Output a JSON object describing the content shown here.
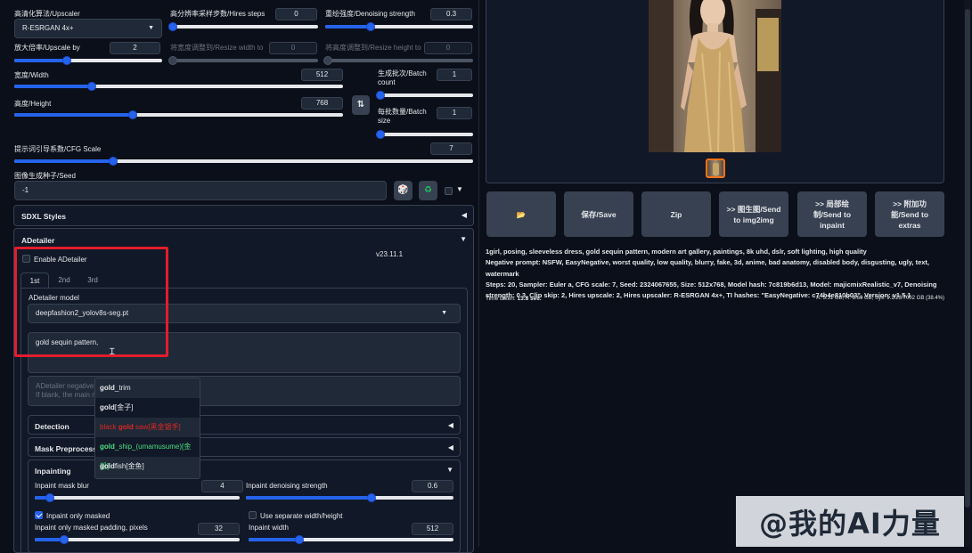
{
  "hires": {
    "upscaler_label": "高清化算法/Upscaler",
    "upscaler_value": "R-ESRGAN 4x+",
    "steps_label": "高分辨率采样步数/Hires steps",
    "steps_value": "0",
    "denoise_label": "重绘强度/Denoising strength",
    "denoise_value": "0.3",
    "upscale_by_label": "放大倍率/Upscale by",
    "upscale_by_value": "2",
    "resize_w_label": "将宽度调整到/Resize width to",
    "resize_w_value": "0",
    "resize_h_label": "将高度调整到/Resize height to",
    "resize_h_value": "0"
  },
  "size": {
    "width_label": "宽度/Width",
    "width_value": "512",
    "height_label": "高度/Height",
    "height_value": "768",
    "batch_count_label": "生成批次/Batch count",
    "batch_count_value": "1",
    "batch_size_label": "每批数量/Batch size",
    "batch_size_value": "1",
    "swap_icon": "swap-icon"
  },
  "cfg": {
    "label": "提示词引导系数/CFG Scale",
    "value": "7"
  },
  "seed": {
    "label": "图像生成种子/Seed",
    "value": "-1"
  },
  "sdxl": {
    "label": "SDXL Styles"
  },
  "adetailer": {
    "title": "ADetailer",
    "enable_label": "Enable ADetailer",
    "version": "v23.11.1",
    "tabs": [
      "1st",
      "2nd",
      "3rd"
    ],
    "model_label": "ADetailer model",
    "model_value": "deepfashion2_yolov8s-seg.pt",
    "prompt_value": "gold sequin pattern,",
    "negative_placeholder_1": "ADetailer negative pr",
    "negative_placeholder_2": "If blank, the main ne",
    "detection_label": "Detection",
    "mask_label": "Mask Preprocessi",
    "inpainting_label": "Inpainting",
    "mask_blur_label": "Inpaint mask blur",
    "mask_blur_value": "4",
    "inpaint_denoise_label": "Inpaint denoising strength",
    "inpaint_denoise_value": "0.6",
    "only_masked_label": "Inpaint only masked",
    "separate_wh_label": "Use separate width/height",
    "padding_label": "Inpaint only masked padding, pixels",
    "padding_value": "32",
    "inpaint_width_label": "Inpaint width",
    "inpaint_width_value": "512"
  },
  "autocomplete": [
    {
      "prefix": "",
      "bold": "gold",
      "rest": "_trim",
      "color": "#e5e7eb"
    },
    {
      "prefix": "",
      "bold": "gold",
      "rest": "[金子]",
      "color": "#e5e7eb"
    },
    {
      "prefix": "black ",
      "bold": "gold",
      "rest": " saw[黑金锯手]",
      "color": "#dc2626"
    },
    {
      "prefix": "",
      "bold": "gold",
      "rest": "_ship_(umamusume)[金船]",
      "color": "#4ade80"
    },
    {
      "prefix": "",
      "bold": "gold",
      "rest": "fish[金鱼]",
      "color": "#e5e7eb"
    }
  ],
  "actions": [
    {
      "name": "open-folder-button",
      "label": "📂"
    },
    {
      "name": "save-button",
      "label": "保存/Save"
    },
    {
      "name": "zip-button",
      "label": "Zip"
    },
    {
      "name": "send-img2img-button",
      "label": ">> 图生图/Send to img2img"
    },
    {
      "name": "send-inpaint-button",
      "label": ">> 局部绘制/Send to inpaint"
    },
    {
      "name": "send-extras-button",
      "label": ">> 附加功能/Send to extras"
    }
  ],
  "info": {
    "prompt": "1girl, posing, sleeveless dress, gold sequin pattern, modern art gallery, paintings, 8k uhd, dslr, soft lighting, high quality",
    "negative": "Negative prompt: NSFW, EasyNegative, worst quality, low quality, blurry, fake, 3d, anime, bad anatomy, disabled body, disgusting, ugly, text, watermark",
    "params": "Steps: 20, Sampler: Euler a, CFG scale: 7, Seed: 2324067655, Size: 512x768, Model hash: 7c819b6d13, Model: majicmixRealistic_v7, Denoising strength: 0.3, Clip skip: 2, Hires upscale: 2, Hires upscaler: R-ESRGAN 4x+, TI hashes: \"EasyNegative: c74b4e810b03\", Version: v1.5.1",
    "time_label": "Time taken:",
    "time_value": "13.8 sec.",
    "vram": "A: 5.31 GB, R: 8.60 GB, Sys: 9.1/23.7002 GB (38.4%)"
  },
  "watermark": "@我的AI力量",
  "colors": {
    "accent": "#2563eb",
    "highlight": "#e11d2e",
    "bg": "#0b0f19"
  }
}
